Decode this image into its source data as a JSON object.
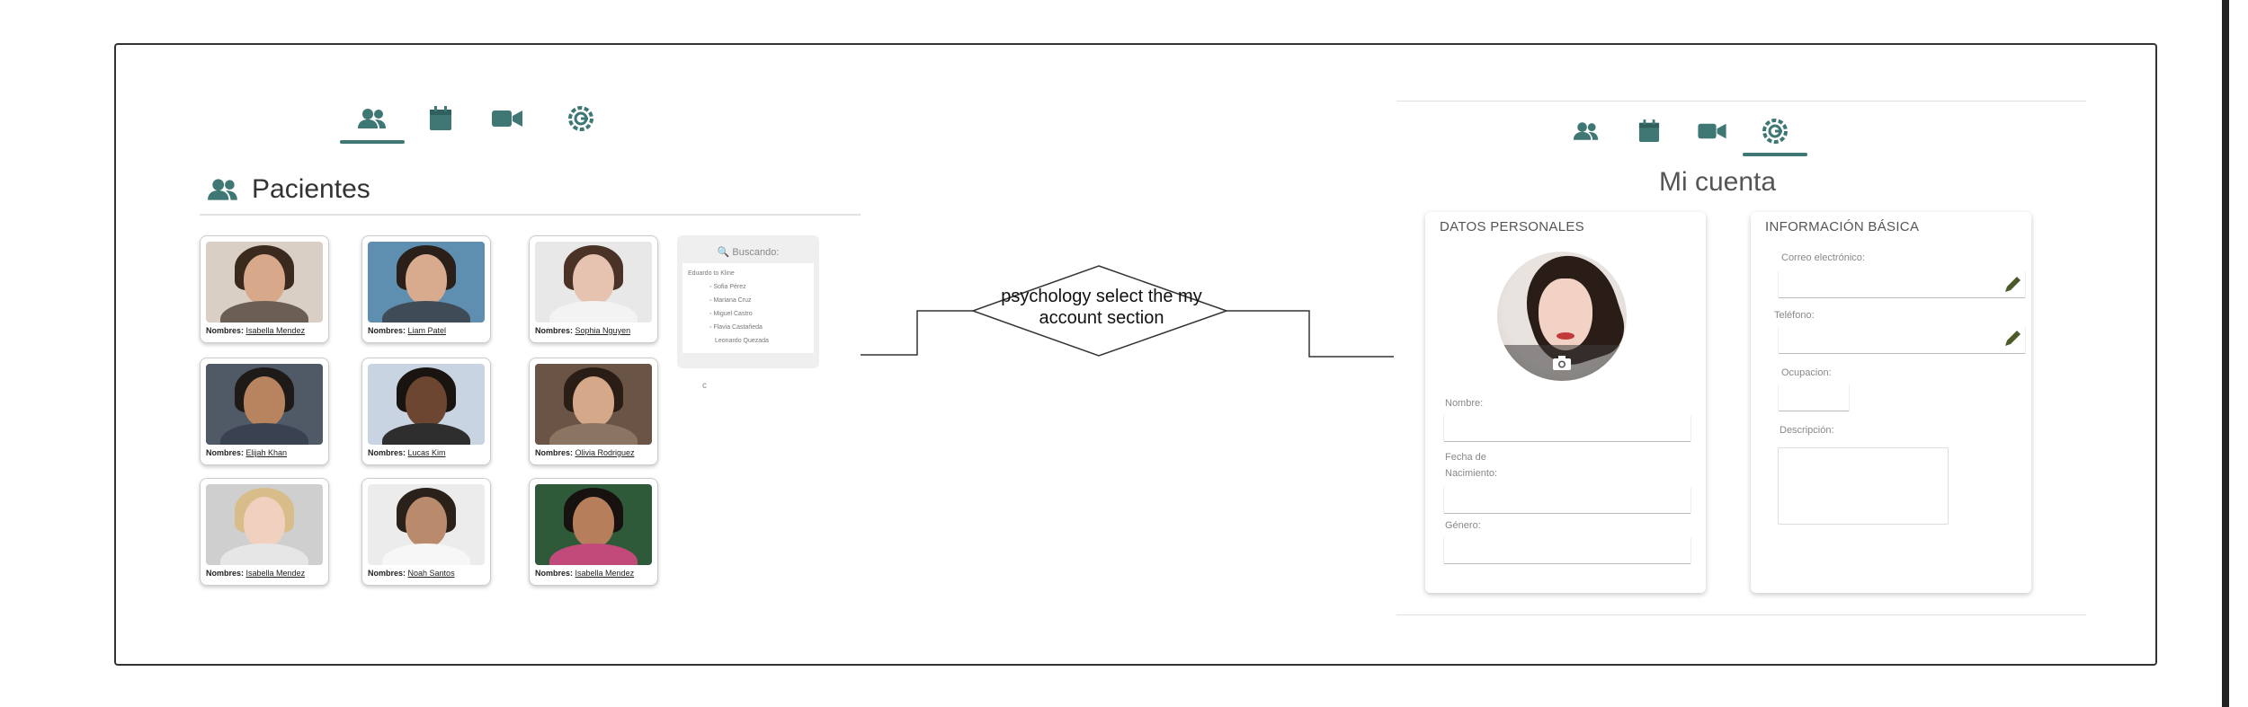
{
  "colors": {
    "accent": "#3f7774",
    "frame": "#333333"
  },
  "left_screen": {
    "tabs": [
      {
        "icon": "users-icon",
        "active": true
      },
      {
        "icon": "calendar-icon",
        "active": false
      },
      {
        "icon": "video-icon",
        "active": false
      },
      {
        "icon": "settings-icon",
        "active": false
      }
    ],
    "section_title": "Pacientes",
    "name_label": "Nombres:",
    "patients": [
      {
        "name": "Isabella Mendez"
      },
      {
        "name": "Liam Patel"
      },
      {
        "name": "Sophia Nguyen"
      },
      {
        "name": "Elijah Khan"
      },
      {
        "name": "Lucas Kim"
      },
      {
        "name": "Olivia Rodriguez"
      },
      {
        "name": "Isabella Mendez"
      },
      {
        "name": "Noah Santos"
      },
      {
        "name": "Isabella Mendez"
      }
    ],
    "search": {
      "title": "Buscando:",
      "first_line": "Eduardo to Kline",
      "results": [
        "Sofia Pérez",
        "Mariana Cruz",
        "Miguel Castro",
        "Flavia Castañeda",
        "Leonardo Quezada"
      ]
    },
    "footer_char": "c"
  },
  "decision": {
    "text": "psychology select the my account section"
  },
  "right_screen": {
    "tabs": [
      {
        "icon": "users-icon",
        "active": false
      },
      {
        "icon": "calendar-icon",
        "active": false
      },
      {
        "icon": "video-icon",
        "active": false
      },
      {
        "icon": "settings-icon",
        "active": true
      }
    ],
    "title": "Mi cuenta",
    "personal": {
      "title": "DATOS PERSONALES",
      "fields": [
        {
          "label": "Nombre:",
          "value": ""
        },
        {
          "label": "Fecha de Nacimiento:",
          "value": ""
        },
        {
          "label": "Género:",
          "value": ""
        }
      ]
    },
    "basic": {
      "title": "INFORMACIÓN BÁSICA",
      "fields": [
        {
          "label": "Correo electrónico:",
          "value": ""
        },
        {
          "label": "Teléfono:",
          "value": ""
        },
        {
          "label": "Ocupacion:",
          "value": ""
        },
        {
          "label": "Descripción:",
          "value": ""
        }
      ]
    }
  }
}
